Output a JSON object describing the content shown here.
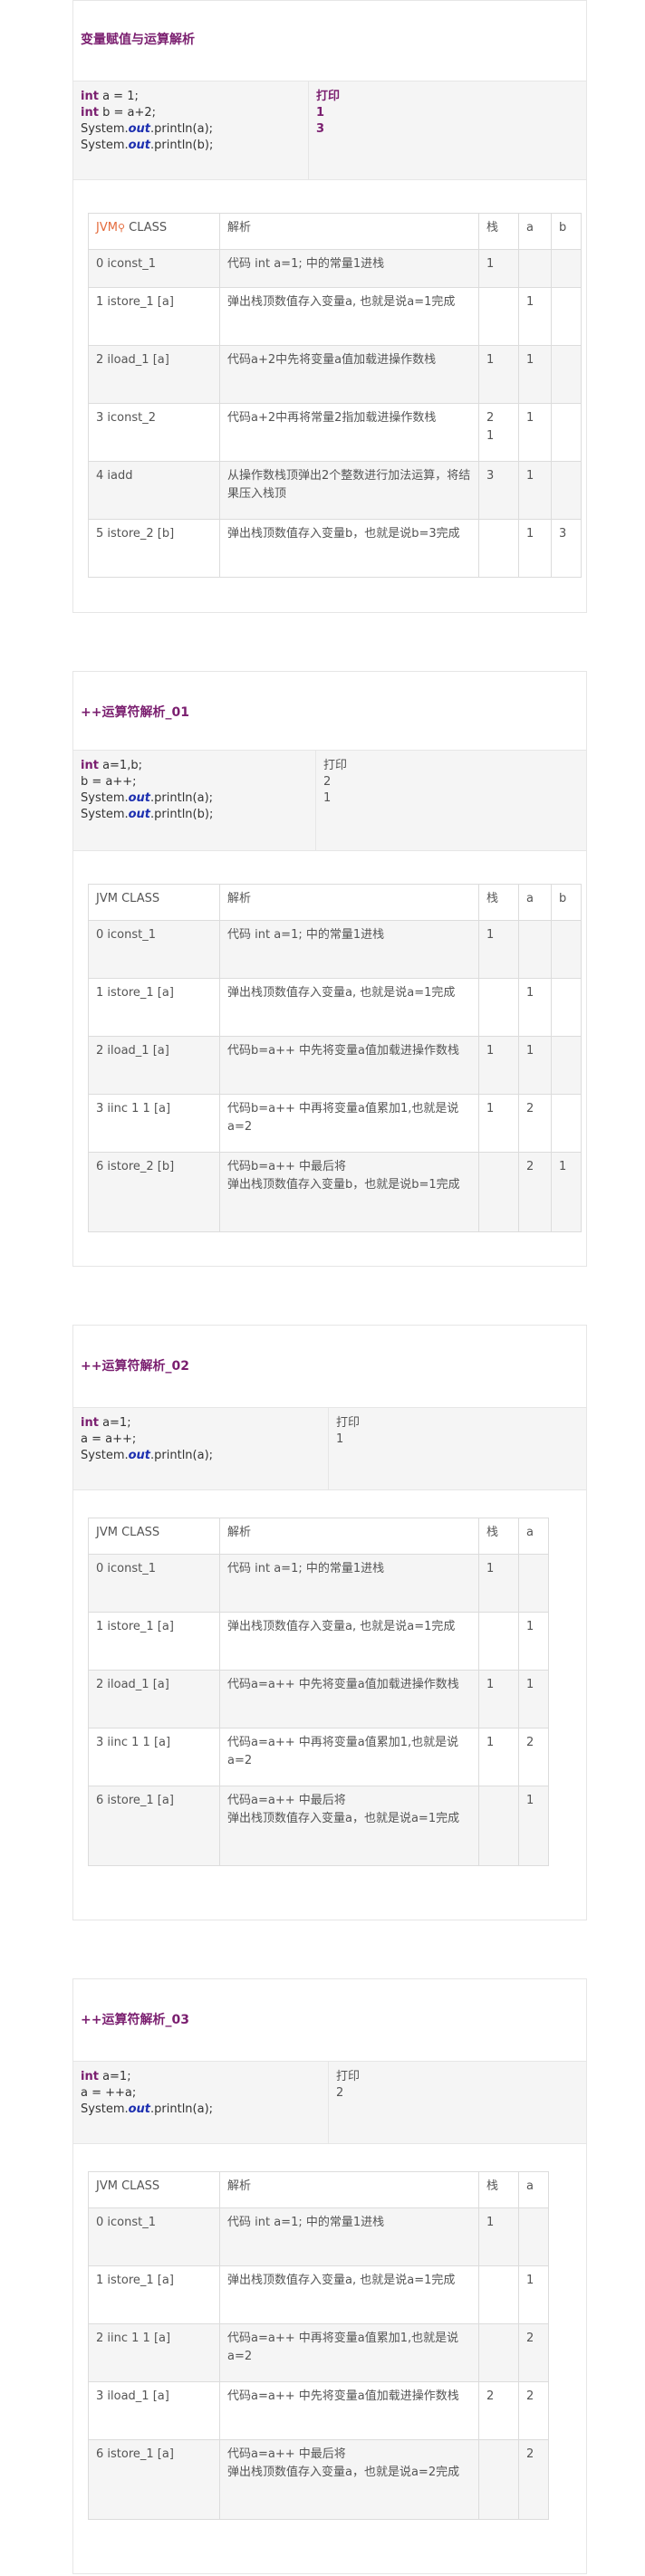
{
  "sections": [
    {
      "title": "变量赋值与运算解析",
      "code_lines": [
        {
          "kw": "int",
          "rest": " a = 1;"
        },
        {
          "kw": "int",
          "rest": " b = a+2;"
        },
        {
          "pre": "System.",
          "out": "out",
          "post": ".println(a);"
        },
        {
          "pre": "System.",
          "out": "out",
          "post": ".println(b);"
        }
      ],
      "output_lines": [
        "打印",
        "1",
        "3"
      ],
      "headers": [
        "JVM CLASS",
        "解析",
        "栈",
        "a",
        "b"
      ],
      "rows": [
        [
          "0  iconst_1",
          "代码 int a=1; 中的常量1进栈",
          "1",
          "",
          ""
        ],
        [
          "1  istore_1 [a]",
          "弹出栈顶数值存入变量a, 也就是说a=1完成",
          "",
          "1",
          ""
        ],
        [
          "2  iload_1 [a]",
          "代码a+2中先将变量a值加载进操作数栈",
          "1",
          "1",
          ""
        ],
        [
          "3  iconst_2",
          "代码a+2中再将常量2指加载进操作数栈",
          "2\n1",
          "1",
          ""
        ],
        [
          "4  iadd",
          "从操作数栈顶弹出2个整数进行加法运算，将结果压入栈顶",
          "3",
          "1",
          ""
        ],
        [
          "5  istore_2 [b]",
          "弹出栈顶数值存入变量b，也就是说b=3完成",
          "",
          "1",
          "3"
        ]
      ]
    },
    {
      "title": "++运算符解析_01",
      "code_lines": [
        {
          "kw": "int",
          "rest": " a=1,b;"
        },
        {
          "plain": "b = a++;"
        },
        {
          "pre": "System.",
          "out": "out",
          "post": ".println(a);"
        },
        {
          "pre": "System.",
          "out": "out",
          "post": ".println(b);"
        }
      ],
      "output_lines": [
        "打印",
        "2",
        "1"
      ],
      "headers": [
        "JVM CLASS",
        "解析",
        "栈",
        "a",
        "b"
      ],
      "rows": [
        [
          "0  iconst_1",
          "代码 int a=1; 中的常量1进栈",
          "1",
          "",
          ""
        ],
        [
          "1  istore_1 [a]",
          "弹出栈顶数值存入变量a, 也就是说a=1完成",
          "",
          "1",
          ""
        ],
        [
          "2  iload_1 [a]",
          "代码b=a++ 中先将变量a值加载进操作数栈",
          "1",
          "1",
          ""
        ],
        [
          "3  iinc 1 1 [a]",
          "代码b=a++ 中再将变量a值累加1,也就是说a=2",
          "1",
          "2",
          ""
        ],
        [
          "6  istore_2 [b]",
          "代码b=a++ 中最后将\n弹出栈顶数值存入变量b，也就是说b=1完成",
          "",
          "2",
          "1"
        ]
      ]
    },
    {
      "title": "++运算符解析_02",
      "code_lines": [
        {
          "kw": "int",
          "rest": " a=1;"
        },
        {
          "plain": "a = a++;"
        },
        {
          "pre": "System.",
          "out": "out",
          "post": ".println(a);"
        }
      ],
      "output_lines": [
        "打印",
        "1"
      ],
      "headers": [
        "JVM CLASS",
        "解析",
        "栈",
        "a"
      ],
      "rows": [
        [
          "0  iconst_1",
          "代码 int a=1; 中的常量1进栈",
          "1",
          ""
        ],
        [
          "1  istore_1 [a]",
          "弹出栈顶数值存入变量a, 也就是说a=1完成",
          "",
          "1"
        ],
        [
          "2  iload_1 [a]",
          "代码a=a++ 中先将变量a值加载进操作数栈",
          "1",
          "1"
        ],
        [
          "3  iinc 1 1 [a]",
          "代码a=a++ 中再将变量a值累加1,也就是说a=2",
          "1",
          "2"
        ],
        [
          "6  istore_1 [a]",
          "代码a=a++ 中最后将\n弹出栈顶数值存入变量a，也就是说a=1完成",
          "",
          "1"
        ]
      ]
    },
    {
      "title": "++运算符解析_03",
      "code_lines": [
        {
          "kw": "int",
          "rest": " a=1;"
        },
        {
          "plain": "a = ++a;"
        },
        {
          "pre": "System.",
          "out": "out",
          "post": ".println(a);"
        }
      ],
      "output_lines": [
        "打印",
        "2"
      ],
      "headers": [
        "JVM CLASS",
        "解析",
        "栈",
        "a"
      ],
      "rows": [
        [
          "0  iconst_1",
          "代码 int a=1; 中的常量1进栈",
          "1",
          ""
        ],
        [
          "1  istore_1 [a]",
          "弹出栈顶数值存入变量a, 也就是说a=1完成",
          "",
          "1"
        ],
        [
          "2  iinc 1 1 [a]",
          "代码a=a++ 中再将变量a值累加1,也就是说a=2",
          "",
          "2"
        ],
        [
          "3  iload_1 [a]",
          "代码a=a++ 中先将变量a值加载进操作数栈",
          "2",
          "2"
        ],
        [
          "6  istore_1 [a]",
          "代码a=a++ 中最后将\n弹出栈顶数值存入变量a，也就是说a=2完成",
          "",
          "2"
        ]
      ]
    }
  ]
}
